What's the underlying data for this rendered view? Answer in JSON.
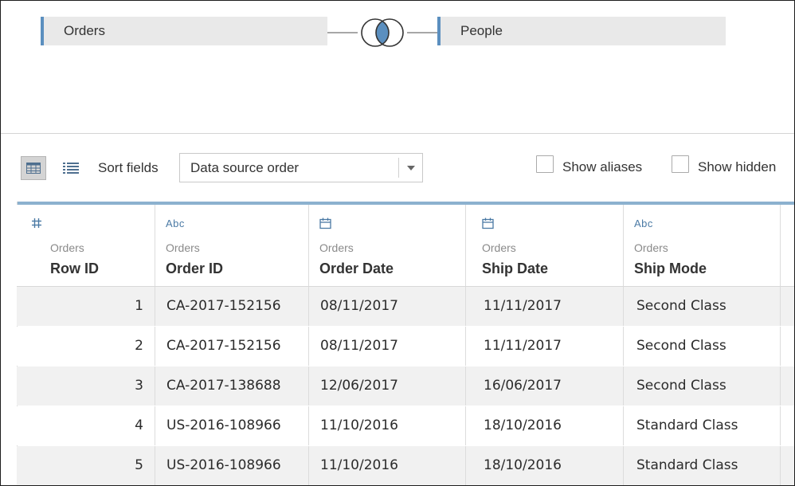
{
  "join": {
    "left_table": "Orders",
    "right_table": "People",
    "join_icon": "left-join-venn-icon",
    "accent_color": "#5b8fbf"
  },
  "toolbar": {
    "grid_view_icon": "grid-view-icon",
    "list_view_icon": "list-view-icon",
    "sort_label": "Sort fields",
    "sort_value": "Data source order",
    "show_aliases_label": "Show aliases",
    "show_aliases_checked": false,
    "show_hidden_label": "Show hidden",
    "show_hidden_checked": false
  },
  "grid": {
    "columns": [
      {
        "type_icon": "#",
        "type_icon_name": "number-type-icon",
        "source": "Orders",
        "name": "Row ID"
      },
      {
        "type_icon": "Abc",
        "type_icon_name": "string-type-icon",
        "source": "Orders",
        "name": "Order ID"
      },
      {
        "type_icon": "",
        "type_icon_name": "date-type-icon",
        "source": "Orders",
        "name": "Order Date"
      },
      {
        "type_icon": "",
        "type_icon_name": "date-type-icon",
        "source": "Orders",
        "name": "Ship Date"
      },
      {
        "type_icon": "Abc",
        "type_icon_name": "string-type-icon",
        "source": "Orders",
        "name": "Ship Mode"
      }
    ],
    "rows": [
      [
        "1",
        "CA-2017-152156",
        "08/11/2017",
        "11/11/2017",
        "Second Class"
      ],
      [
        "2",
        "CA-2017-152156",
        "08/11/2017",
        "11/11/2017",
        "Second Class"
      ],
      [
        "3",
        "CA-2017-138688",
        "12/06/2017",
        "16/06/2017",
        "Second Class"
      ],
      [
        "4",
        "US-2016-108966",
        "11/10/2016",
        "18/10/2016",
        "Standard Class"
      ],
      [
        "5",
        "US-2016-108966",
        "11/10/2016",
        "18/10/2016",
        "Standard Class"
      ]
    ]
  }
}
